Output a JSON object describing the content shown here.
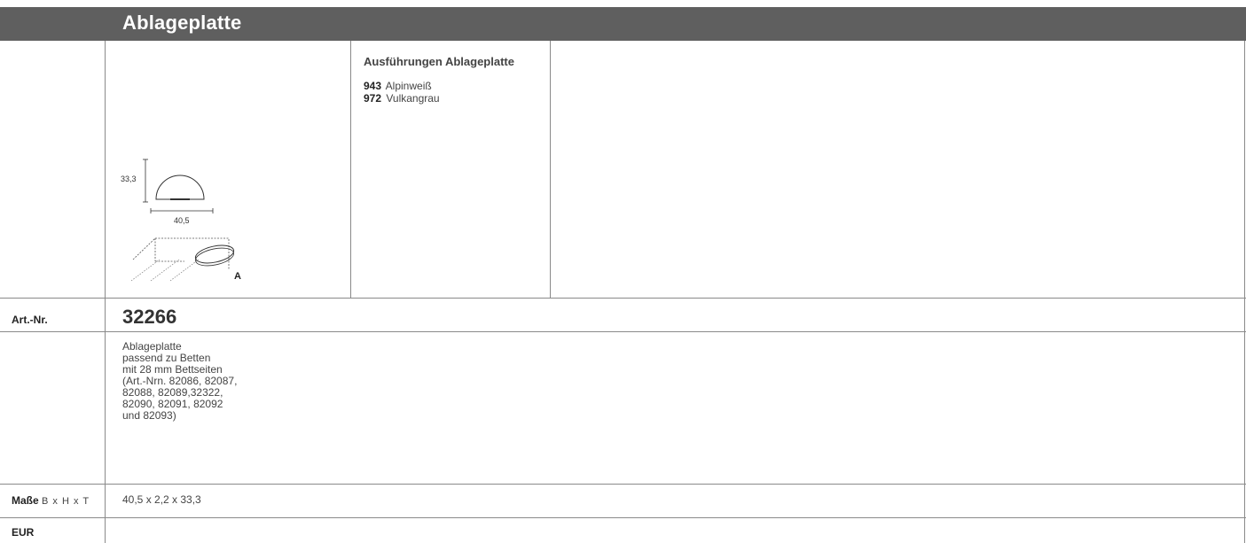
{
  "header": {
    "title": "Ablageplatte"
  },
  "variants": {
    "title": "Ausführungen Ablageplatte",
    "items": [
      {
        "code": "943",
        "name": "Alpinweiß"
      },
      {
        "code": "972",
        "name": "Vulkangrau"
      }
    ]
  },
  "drawing": {
    "height_label": "33,3",
    "width_label": "40,5",
    "detail_label": "A"
  },
  "article": {
    "label": "Art.-Nr.",
    "number": "32266"
  },
  "description": {
    "lines": [
      "Ablageplatte",
      "passend zu Betten",
      "mit 28 mm Bettseiten",
      "(Art.-Nrn. 82086, 82087,",
      "82088, 82089,32322,",
      "82090, 82091, 82092",
      "und 82093)"
    ]
  },
  "dimensions": {
    "label": "Maße",
    "axes": "B x H x T",
    "value": "40,5 x 2,2 x 33,3"
  },
  "price": {
    "label": "EUR"
  }
}
